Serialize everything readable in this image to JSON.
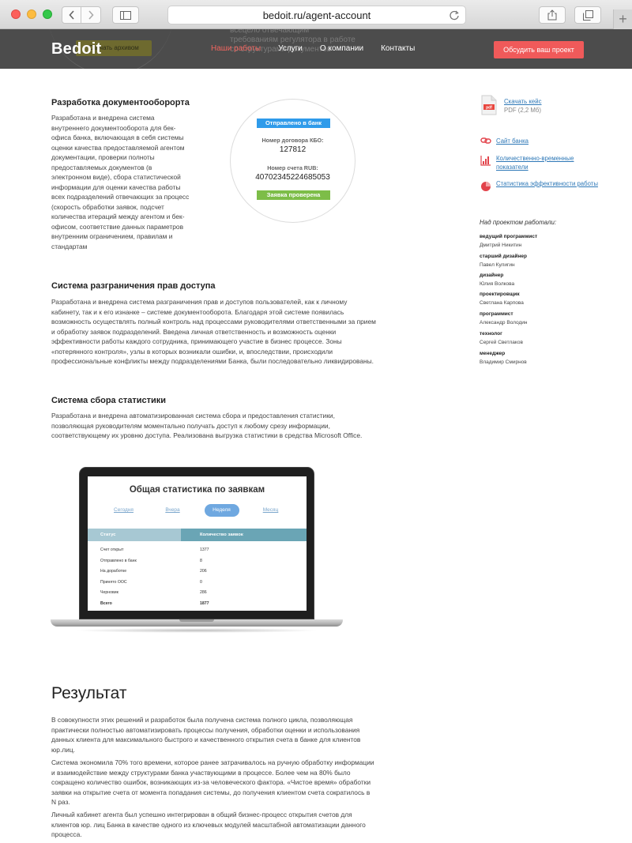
{
  "browser": {
    "url": "bedoit.ru/agent-account"
  },
  "header": {
    "logo": "Bedoit",
    "ghost_text": "всецело отвечающим требованиям регулятора в работе со структурами документов",
    "ghost_button": "Скачать архивом",
    "menu": [
      {
        "label": "Наши работы",
        "active": true
      },
      {
        "label": "Услуги",
        "active": false
      },
      {
        "label": "О компании",
        "active": false
      },
      {
        "label": "Контакты",
        "active": false
      }
    ],
    "cta": "Обсудить ваш проект",
    "accent_color": "#f05a5a"
  },
  "sections": {
    "docflow": {
      "title": "Разработка документооборорта",
      "text": "Разработана и внедрена система внутреннего документооборота для бек-офиса банка, включающая в себя системы оценки качества предоставляемой агентом документации, проверки полноты предоставляемых документов (в электронном виде), сбора статистической информации для оценки качества работы всех подразделений отвечающих за процесс (скорость обработки заявок, подсчет количества итераций между агентом и бек-офисом, соответствие данных параметров внутренним ограничением, правилам и стандартам"
    },
    "access": {
      "title": "Система разграничения прав доступа",
      "text": "Разработана и внедрена система разграничения прав и доступов пользователей, как к личному кабинету, так и к его изнанке – системе документооборота. Благодаря этой системе появилась возможность осуществлять полный контроль над процессами руководителями ответственными за прием и обработку заявок подразделений. Введена личная ответственность и возможность оценки эффективности работы каждого сотрудника, принимающего участие в бизнес процессе. Зоны «потерянного контроля», узлы в которых возникали ошибки, и, впоследствии, происходили профессиональные конфликты между подразделениями Банка, были последовательно ликвидированы."
    },
    "stats": {
      "title": "Система сбора статистики",
      "text": "Разработана и внедрена автоматизированная система сбора и предоставления статистики, позволяющая руководителям моментально получать доступ к любому срезу информации, соответствующему их уровню доступа. Реализована выгрузка статистики в средства Microsoft Office."
    },
    "result": {
      "title": "Результат",
      "p1": "В совокупности этих решений и разработок была получена система полного цикла, позволяющая практически полностью автоматизировать процессы получения, обработки оценки и использования данных клиента для максимального быстрого и качественного открытия счета в банке для клиентов юр.лиц.",
      "p2": "Система экономила 70% того времени, которое ранее затрачивалось на ручную обработку информации и взаимодействие между структурами банка участвующими в процессе. Более чем на 80% было сокращено количество ошибок, возникающих из-за человеческого фактора. «Чистое время» обработки заявки на открытие счета от момента попадания системы, до получения клиентом счета сократилось в N раз.",
      "p3": "Личный кабинет агента был успешно интегрирован в общий бизнес-процесс открытия счетов для клиентов юр. лиц Банка в качестве одного из ключевых модулей масштабной автоматизации данного процесса."
    }
  },
  "status_card": {
    "badge_sent": "Отправлено в банк",
    "contract_label": "Номер договора КБО:",
    "contract_value": "127812",
    "account_label": "Номер счета RUB:",
    "account_value": "40702345224685053",
    "badge_checked": "Заявка проверена"
  },
  "sidebar": {
    "download": {
      "label": "Скачать кейс",
      "meta": "PDF (2,2 Мб)",
      "icon": "pdf-file-icon"
    },
    "links": [
      {
        "label": "Сайт банка",
        "icon": "link-icon"
      },
      {
        "label": "Количественно-временные показатели",
        "icon": "bar-chart-icon"
      },
      {
        "label": "Статистика эффективности работы",
        "icon": "pie-chart-icon"
      }
    ],
    "team_title": "Над проектом работали:",
    "team": [
      {
        "role": "ведущий программист",
        "name": "Дмитрий Никитин"
      },
      {
        "role": "старший дизайнер",
        "name": "Павел Кулигин"
      },
      {
        "role": "дизайнер",
        "name": "Юлия Волкова"
      },
      {
        "role": "проектировщик",
        "name": "Светлана Карпова"
      },
      {
        "role": "программист",
        "name": "Александр Володин"
      },
      {
        "role": "технолог",
        "name": "Сергей Светлаков"
      },
      {
        "role": "менеджер",
        "name": "Владимир Смирнов"
      }
    ]
  },
  "laptop_screen": {
    "title": "Общая статистика по заявкам",
    "tabs": [
      {
        "label": "Сегодня",
        "active": false
      },
      {
        "label": "Вчера",
        "active": false
      },
      {
        "label": "Неделя",
        "active": true
      },
      {
        "label": "Месяц",
        "active": false
      }
    ],
    "columns": [
      "Статус",
      "Количество заявок"
    ],
    "rows": [
      {
        "status": "Счет открыт",
        "count": "1377"
      },
      {
        "status": "Отправлено в банк",
        "count": "8"
      },
      {
        "status": "На доработке",
        "count": "206"
      },
      {
        "status": "Принято ООС",
        "count": "0"
      },
      {
        "status": "Черновик",
        "count": "286"
      },
      {
        "status": "Всего",
        "count": "1877"
      }
    ]
  }
}
